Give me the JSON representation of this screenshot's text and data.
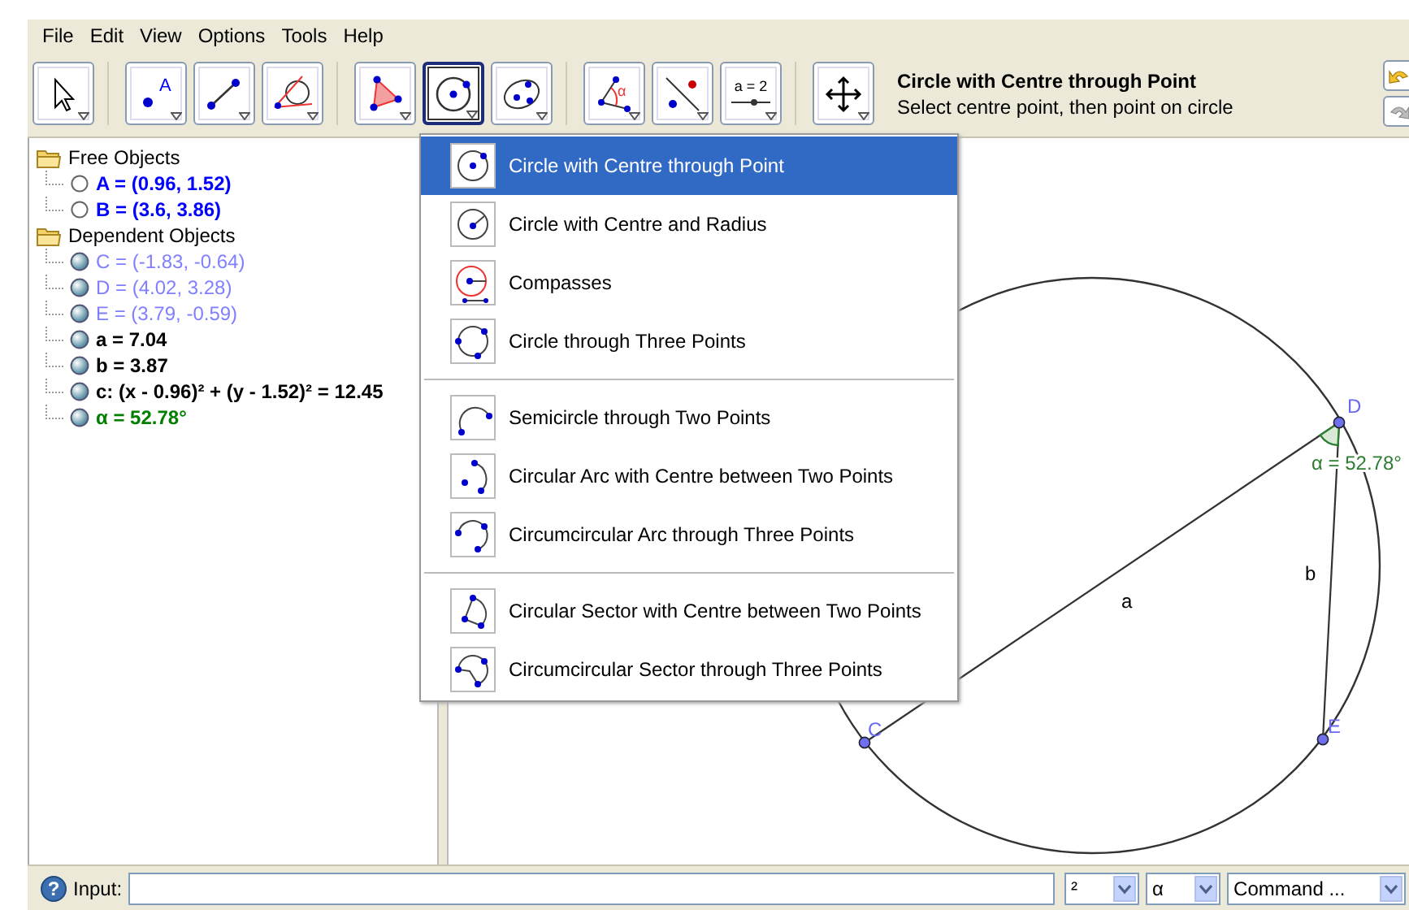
{
  "menu": [
    "File",
    "Edit",
    "View",
    "Options",
    "Tools",
    "Help"
  ],
  "toolbar": [
    [
      {
        "kind": "move",
        "selected": false
      }
    ],
    [
      {
        "kind": "point",
        "glyph": "A",
        "selected": false
      },
      {
        "kind": "segment",
        "selected": false
      },
      {
        "kind": "tangent",
        "selected": false
      }
    ],
    [
      {
        "kind": "polygon",
        "selected": false
      },
      {
        "kind": "circle",
        "selected": true
      },
      {
        "kind": "conic",
        "selected": false
      }
    ],
    [
      {
        "kind": "angle",
        "glyph": "α",
        "selected": false
      },
      {
        "kind": "reflect",
        "selected": false
      },
      {
        "kind": "slider",
        "glyph": "a = 2",
        "selected": false
      }
    ],
    [
      {
        "kind": "move_view",
        "selected": false
      }
    ]
  ],
  "tool_help": {
    "title": "Circle with Centre through Point",
    "hint": "Select centre point, then point on circle"
  },
  "algebra": [
    {
      "label": "Free Objects",
      "children": [
        {
          "text": "A = (0.96, 1.52)",
          "color": "#0000ff",
          "bold": true,
          "shown": false
        },
        {
          "text": "B = (3.6, 3.86)",
          "color": "#0000ff",
          "bold": true,
          "shown": false
        }
      ]
    },
    {
      "label": "Dependent Objects",
      "children": [
        {
          "text": "C = (-1.83, -0.64)",
          "color": "#7f7fff",
          "bold": false,
          "shown": true
        },
        {
          "text": "D = (4.02, 3.28)",
          "color": "#7f7fff",
          "bold": false,
          "shown": true
        },
        {
          "text": "E = (3.79, -0.59)",
          "color": "#7f7fff",
          "bold": false,
          "shown": true
        },
        {
          "text": "a = 7.04",
          "color": "#000000",
          "bold": true,
          "shown": true
        },
        {
          "text": "b = 3.87",
          "color": "#000000",
          "bold": true,
          "shown": true
        },
        {
          "text": "c: (x - 0.96)² + (y - 1.52)² = 12.45",
          "color": "#000000",
          "bold": true,
          "shown": true
        },
        {
          "text": "α = 52.78°",
          "color": "#007f00",
          "bold": true,
          "shown": true
        }
      ]
    }
  ],
  "dropdown": [
    [
      {
        "kind": "circle_centre_point",
        "label": "Circle with Centre through Point",
        "selected": true
      },
      {
        "kind": "circle_centre_radius",
        "label": "Circle with Centre and Radius",
        "selected": false
      },
      {
        "kind": "compasses",
        "label": "Compasses",
        "selected": false
      },
      {
        "kind": "circle_three_points",
        "label": "Circle through Three Points",
        "selected": false
      }
    ],
    [
      {
        "kind": "semicircle",
        "label": "Semicircle through Two Points",
        "selected": false
      },
      {
        "kind": "arc_centre",
        "label": "Circular Arc with Centre between Two Points",
        "selected": false
      },
      {
        "kind": "circumcircular_arc",
        "label": "Circumcircular Arc through Three Points",
        "selected": false
      }
    ],
    [
      {
        "kind": "sector_centre",
        "label": "Circular Sector with Centre between Two Points",
        "selected": false
      },
      {
        "kind": "circumcircular_sector",
        "label": "Circumcircular Sector through Three Points",
        "selected": false
      }
    ]
  ],
  "graphics": {
    "points": [
      {
        "label": "C"
      },
      {
        "label": "D"
      },
      {
        "label": "E"
      }
    ],
    "segments": [
      {
        "label": "a"
      },
      {
        "label": "b"
      }
    ],
    "angle": {
      "label": "α = 52.78°"
    }
  },
  "input_bar": {
    "help": "?",
    "label": "Input:",
    "selectors": [
      "²",
      "α",
      "Command ..."
    ]
  }
}
